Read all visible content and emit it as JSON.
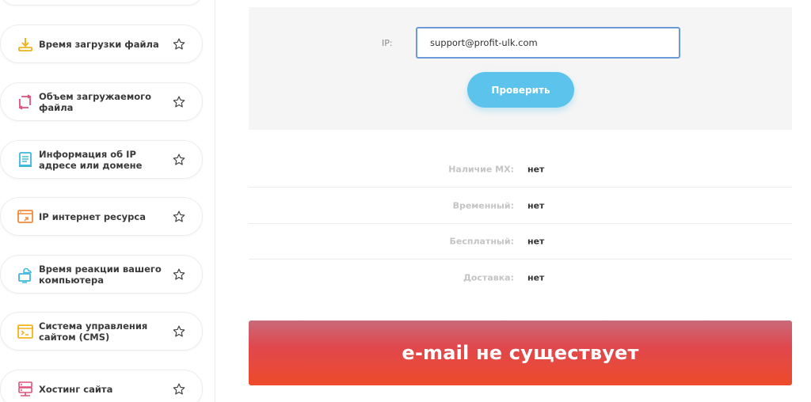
{
  "sidebar": {
    "items": [
      {
        "label": "Время загрузки файла",
        "icon": "download-icon",
        "icon_color": "#f2b21b"
      },
      {
        "label": "Объем загружаемого файла",
        "icon": "resize-icon",
        "icon_color": "#e2507a"
      },
      {
        "label": "Информация об IP адресе или домене",
        "icon": "document-icon",
        "icon_color": "#3fb8dd"
      },
      {
        "label": "IP интернет ресурса",
        "icon": "browser-link-icon",
        "icon_color": "#f08a3a"
      },
      {
        "label": "Время реакции вашего компьютера",
        "icon": "cloud-computer-icon",
        "icon_color": "#3fb8dd"
      },
      {
        "label": "Система управления сайтом (CMS)",
        "icon": "terminal-icon",
        "icon_color": "#f2b21b"
      },
      {
        "label": "Хостинг сайта",
        "icon": "server-icon",
        "icon_color": "#e2507a"
      }
    ]
  },
  "form": {
    "ip_label": "IP:",
    "input_value": "support@profit-ulk.com",
    "check_label": "Проверить"
  },
  "results": [
    {
      "label": "Наличие MX:",
      "value": "нет"
    },
    {
      "label": "Временный:",
      "value": "нет"
    },
    {
      "label": "Бесплатный:",
      "value": "нет"
    },
    {
      "label": "Доставка:",
      "value": "нет"
    }
  ],
  "banner": {
    "text": "e-mail не существует",
    "color_top": "#c86a7a",
    "color_bottom": "#ee4a2a"
  },
  "colors": {
    "accent_button": "#5bc3ec",
    "input_border": "#6a9bd8",
    "panel_background": "#f5f5f5"
  }
}
